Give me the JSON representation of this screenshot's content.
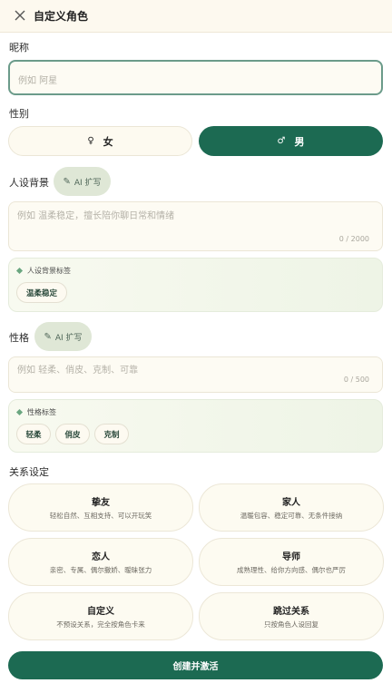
{
  "header": {
    "title": "自定义角色",
    "close_icon": "close-icon"
  },
  "nickname": {
    "label": "昵称",
    "placeholder": "例如 阿星"
  },
  "gender": {
    "label": "性别",
    "female": {
      "symbol": "♀",
      "label": "女"
    },
    "male": {
      "symbol": "♂",
      "label": "男"
    },
    "selected": "男"
  },
  "background": {
    "label": "人设背景",
    "ai_label": "AI 扩写",
    "placeholder": "例如 温柔稳定，擅长陪你聊日常和情绪",
    "counter": "0 / 2000",
    "tags_title": "人设背景标签",
    "tags": [
      "温柔稳定"
    ]
  },
  "personality": {
    "label": "性格",
    "ai_label": "AI 扩写",
    "placeholder": "例如 轻柔、俏皮、克制、可靠",
    "counter": "0 / 500",
    "tags_title": "性格标签",
    "tags": [
      "轻柔",
      "俏皮",
      "克制"
    ]
  },
  "relationship": {
    "label": "关系设定",
    "options": [
      {
        "title": "挚友",
        "desc": "轻松自然、互相支持、可以开玩笑"
      },
      {
        "title": "家人",
        "desc": "温暖包容、稳定可靠、无条件接纳"
      },
      {
        "title": "恋人",
        "desc": "亲密、专属、偶尔撒娇、暧昧张力"
      },
      {
        "title": "导师",
        "desc": "成熟理性、给你方向感、偶尔也严厉"
      },
      {
        "title": "自定义",
        "desc": "不预设关系，完全按角色卡来"
      },
      {
        "title": "跳过关系",
        "desc": "只按角色人设回复"
      }
    ]
  },
  "submit_label": "创建并激活",
  "colors": {
    "primary": "#1c6a52",
    "chip_bg": "#dfe7d6",
    "header_bg": "#fdf9ef"
  }
}
